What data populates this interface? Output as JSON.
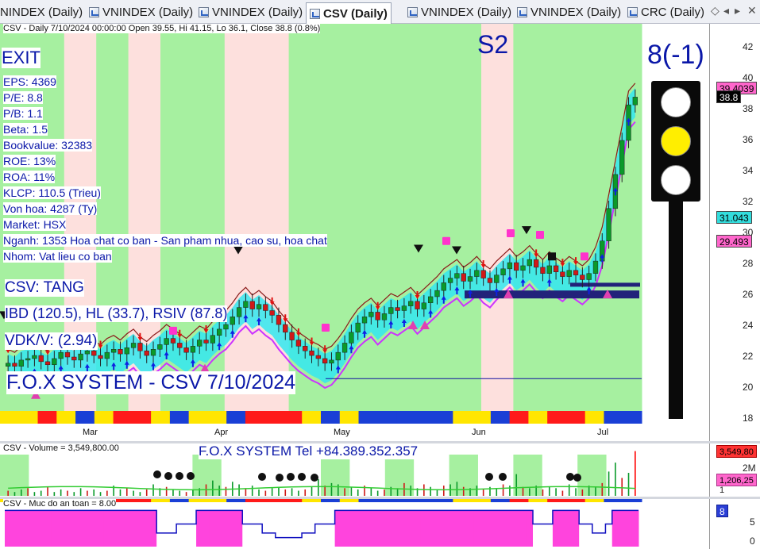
{
  "tabs": [
    {
      "label": "NINDEX (Daily)",
      "active": false
    },
    {
      "label": "VNINDEX (Daily)",
      "active": false
    },
    {
      "label": "VNINDEX (Daily)",
      "active": false
    },
    {
      "label": "CSV (Daily)",
      "active": true
    },
    {
      "label": "VNINDEX (Daily)",
      "active": false
    },
    {
      "label": "VNINDEX (Daily)",
      "active": false
    },
    {
      "label": "CRC (Daily)",
      "active": false
    }
  ],
  "tab_controls": {
    "pin": "◇",
    "prev": "◂",
    "next": "▸",
    "close": "✕"
  },
  "main": {
    "header": "CSV - Daily 7/10/2024 00:00:00 Open 39.55, Hi 41.15, Lo 36.1, Close 38.8 (0.8%)",
    "signal": "EXIT",
    "stage": "S2",
    "score": "8(-1)",
    "fundamentals": [
      "EPS: 4369",
      "P/E: 8.8",
      "P/B: 1.1",
      "Beta: 1.5",
      "Bookvalue: 32383",
      "ROE: 13%",
      "ROA: 11%",
      "KLCP: 110.5 (Trieu)",
      "Von hoa: 4287 (Ty)",
      "Market: HSX",
      "Nganh: 1353 Hoa chat co ban - San pham nhua, cao su, hoa chat",
      "Nhom: Vat lieu co ban"
    ],
    "trend": "CSV: TANG",
    "ratings": "IBD (120.5), HL (33.7), RSIV (87.8)",
    "vdk": "VDK/V:  (2.94)",
    "watermark": "F.O.X SYSTEM - CSV 7/10/2024",
    "traffic_light": [
      "white",
      "yellow",
      "white"
    ]
  },
  "price_axis": {
    "ticks": [
      "42",
      "40",
      "38",
      "36",
      "34",
      "32",
      "30",
      "28",
      "26",
      "24",
      "22",
      "20",
      "18"
    ],
    "tags": [
      {
        "value": "39.4039",
        "color": "#ff66cc"
      },
      {
        "value": "38.8",
        "color": "#000000"
      },
      {
        "value": "31.043",
        "color": "#33dddd"
      },
      {
        "value": "29.493",
        "color": "#ff66cc"
      }
    ]
  },
  "months": [
    "Mar",
    "Apr",
    "May",
    "Jun",
    "Jul"
  ],
  "volume": {
    "header": "CSV - Volume = 3,549,800.00",
    "contact": "F.O.X SYSTEM Tel +84.389.352.357",
    "ticks": [
      "2M",
      "1"
    ],
    "tags": [
      {
        "value": "3,549,80",
        "color": "#ff3333"
      },
      {
        "value": "1,206,25",
        "color": "#ff66cc"
      }
    ]
  },
  "safety": {
    "header": "CSV - Muc do an toan = 8.00",
    "ticks": [
      "5",
      "0"
    ],
    "tag": "8"
  },
  "chart_data": {
    "type": "candlestick",
    "symbol": "CSV",
    "x": [
      "Mar",
      "Apr",
      "May",
      "Jun",
      "Jul"
    ],
    "ylim": [
      18,
      42
    ],
    "last": {
      "open": 39.55,
      "high": 41.15,
      "low": 36.1,
      "close": 38.8,
      "change": "0.8%",
      "volume": 3549800
    },
    "close_path": [
      21.6,
      21.4,
      21.8,
      21.9,
      22.1,
      21.7,
      21.5,
      21.9,
      22.3,
      22.0,
      21.8,
      22.2,
      22.4,
      22.1,
      21.9,
      22.3,
      22.5,
      22.2,
      22.6,
      22.9,
      22.4,
      22.1,
      22.5,
      22.8,
      23.2,
      22.9,
      22.6,
      22.3,
      22.7,
      23.1,
      22.9,
      23.4,
      23.8,
      24.1,
      24.6,
      25.2,
      25.6,
      25.1,
      25.4,
      25.0,
      24.7,
      24.1,
      23.6,
      23.1,
      22.7,
      22.4,
      22.1,
      21.9,
      21.6,
      21.8,
      22.3,
      22.9,
      23.6,
      24.2,
      24.6,
      24.9,
      24.4,
      24.8,
      25.2,
      25.0,
      25.3,
      25.6,
      25.1,
      25.5,
      25.9,
      26.3,
      26.8,
      27.1,
      27.4,
      26.9,
      27.2,
      27.6,
      27.1,
      26.8,
      27.3,
      27.7,
      28.1,
      27.6,
      27.9,
      28.3,
      27.8,
      27.4,
      27.9,
      27.5,
      27.2,
      27.6,
      27.3,
      27.0,
      27.4,
      28.2,
      29.5,
      31.6,
      33.8,
      36.0,
      38.3,
      38.8
    ],
    "volume_path": [
      0.4,
      0.3,
      0.5,
      0.6,
      0.3,
      0.4,
      0.7,
      0.3,
      0.5,
      0.4,
      0.3,
      0.6,
      0.4,
      0.5,
      0.3,
      0.4,
      0.8,
      0.5,
      0.6,
      0.4,
      0.3,
      0.5,
      0.9,
      0.6,
      0.7,
      0.5,
      0.4,
      0.3,
      0.5,
      0.6,
      0.9,
      1.2,
      0.8,
      0.7,
      1.1,
      0.9,
      0.6,
      0.8,
      0.5,
      0.4,
      0.6,
      0.7,
      0.5,
      0.6,
      0.4,
      0.5,
      0.7,
      1.3,
      0.8,
      1.0,
      0.9,
      0.6,
      0.7,
      0.5,
      0.8,
      0.6,
      0.4,
      0.5,
      0.7,
      0.6,
      1.0,
      0.8,
      0.6,
      0.9,
      0.7,
      0.5,
      0.8,
      0.9,
      1.1,
      0.7,
      0.6,
      0.8,
      0.5,
      0.7,
      0.6,
      0.9,
      0.8,
      1.7,
      0.7,
      0.6,
      0.8,
      0.5,
      0.7,
      0.6,
      0.4,
      0.9,
      0.6,
      0.5,
      0.8,
      0.7,
      1.0,
      1.9,
      2.6,
      1.4,
      1.8,
      3.5
    ],
    "safety_path": [
      8,
      8,
      8,
      8,
      8,
      8,
      8,
      8,
      8,
      8,
      8,
      8,
      8,
      8,
      8,
      8,
      8,
      8,
      8,
      8,
      8,
      8,
      8,
      3,
      3,
      3,
      5,
      5,
      5,
      8,
      8,
      8,
      8,
      8,
      8,
      8,
      5,
      5,
      5,
      3,
      3,
      2,
      2,
      2,
      2,
      3,
      3,
      5,
      5,
      5,
      8,
      8,
      8,
      8,
      8,
      8,
      8,
      8,
      8,
      8,
      8,
      8,
      8,
      8,
      8,
      8,
      8,
      8,
      8,
      8,
      8,
      8,
      8,
      8,
      8,
      8,
      8,
      8,
      8,
      8,
      5,
      5,
      5,
      8,
      8,
      8,
      8,
      5,
      5,
      3,
      3,
      5,
      8,
      8,
      8,
      8
    ],
    "zones": [
      "green",
      "green",
      "red",
      "green",
      "red",
      "green",
      "green",
      "red",
      "red",
      "green",
      "green",
      "green",
      "green",
      "green",
      "green",
      "red",
      "green",
      "green",
      "green",
      "green"
    ]
  }
}
